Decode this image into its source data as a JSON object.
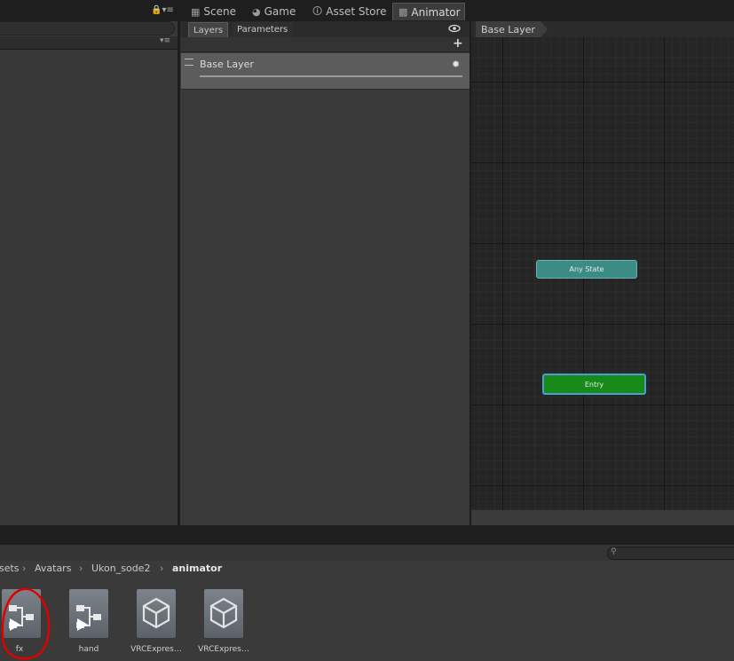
{
  "top_tabs": {
    "scene": "Scene",
    "game": "Game",
    "asset_store": "Asset Store",
    "animator": "Animator"
  },
  "left_panel": {
    "menu": "▾≡"
  },
  "animator": {
    "tabs": {
      "layers": "Layers",
      "parameters": "Parameters"
    },
    "add_label": "+",
    "layer": {
      "name": "Base Layer"
    },
    "breadcrumb": "Base Layer",
    "states": {
      "any_state": "Any State",
      "entry": "Entry"
    }
  },
  "project": {
    "breadcrumb": [
      "sets",
      "Avatars",
      "Ukon_sode2",
      "animator"
    ],
    "assets": [
      {
        "label": "fx",
        "icon": "animator-controller-icon"
      },
      {
        "label": "hand",
        "icon": "animator-controller-icon"
      },
      {
        "label": "VRCExpres…",
        "icon": "unity-asset-icon"
      },
      {
        "label": "VRCExpres…",
        "icon": "unity-asset-icon"
      }
    ]
  },
  "colors": {
    "annotation": "#e00000",
    "any_state": "#3b8c85",
    "entry": "#178a1a",
    "entry_selection": "#4a9fd0"
  }
}
